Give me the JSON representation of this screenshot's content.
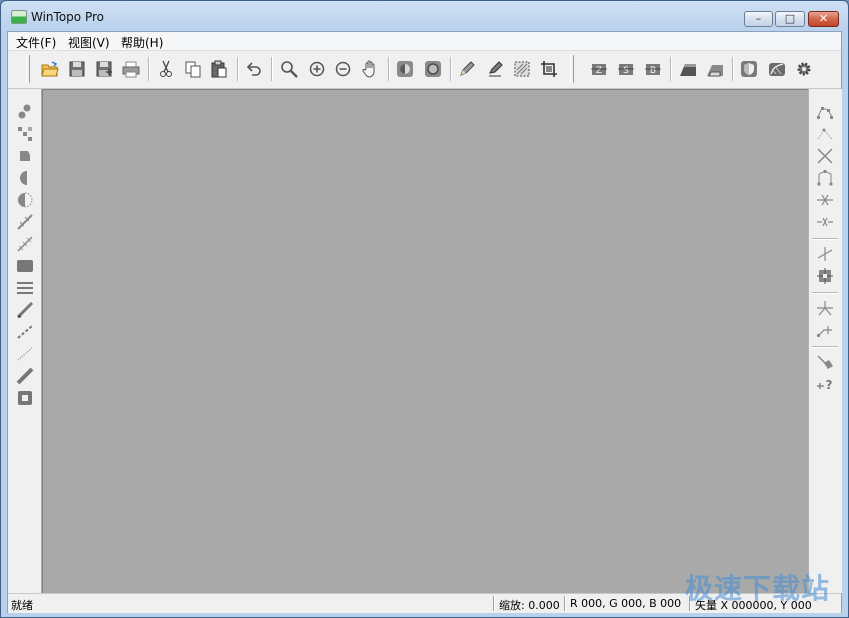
{
  "window": {
    "title": "WinTopo Pro",
    "controls": {
      "minimize": "–",
      "maximize": "□",
      "close": "✕"
    }
  },
  "menubar": {
    "items": [
      {
        "label": "文件(F)"
      },
      {
        "label": "视图(V)"
      },
      {
        "label": "帮助(H)"
      }
    ]
  },
  "toolbar": {
    "buttons": [
      {
        "name": "open-icon"
      },
      {
        "name": "save-icon"
      },
      {
        "name": "save-as-icon"
      },
      {
        "name": "print-icon"
      },
      {
        "name": "cut-icon"
      },
      {
        "name": "copy-icon"
      },
      {
        "name": "paste-icon"
      },
      {
        "name": "undo-icon"
      },
      {
        "name": "magnifier-icon"
      },
      {
        "name": "zoom-in-icon"
      },
      {
        "name": "zoom-out-icon"
      },
      {
        "name": "pan-hand-icon"
      },
      {
        "name": "brightness-icon"
      },
      {
        "name": "contrast-icon"
      },
      {
        "name": "pencil-icon"
      },
      {
        "name": "highlighter-icon"
      },
      {
        "name": "select-area-icon"
      },
      {
        "name": "crop-icon"
      },
      {
        "name": "vector-z-icon"
      },
      {
        "name": "vector-s-icon"
      },
      {
        "name": "vector-b-icon"
      },
      {
        "name": "thinning-icon"
      },
      {
        "name": "skeleton-icon"
      },
      {
        "name": "shield-icon"
      },
      {
        "name": "vectorize-icon"
      },
      {
        "name": "settings-gear-icon"
      }
    ]
  },
  "left_tools": [
    {
      "name": "draw-dots-icon"
    },
    {
      "name": "move-nodes-icon"
    },
    {
      "name": "fill-shape-icon"
    },
    {
      "name": "half-circle-icon"
    },
    {
      "name": "mirror-circle-icon"
    },
    {
      "name": "draw-line-icon"
    },
    {
      "name": "dashed-line-icon"
    },
    {
      "name": "filled-rectangle-icon"
    },
    {
      "name": "horizontal-lines-icon"
    },
    {
      "name": "diagonal-bar-icon"
    },
    {
      "name": "dotted-line-icon"
    },
    {
      "name": "fine-dotted-line-icon"
    },
    {
      "name": "thick-stroke-icon"
    },
    {
      "name": "square-ring-icon"
    }
  ],
  "right_tools": [
    {
      "name": "polyline-icon"
    },
    {
      "name": "dotted-polyline-icon"
    },
    {
      "name": "cross-lines-icon"
    },
    {
      "name": "curve-nodes-icon"
    },
    {
      "name": "join-lines-icon"
    },
    {
      "name": "break-lines-icon"
    },
    {
      "name": "snap-point-icon"
    },
    {
      "name": "node-box-icon"
    },
    {
      "name": "intersection-icon"
    },
    {
      "name": "extend-line-icon"
    },
    {
      "name": "delete-node-icon"
    },
    {
      "name": "help-node-icon"
    }
  ],
  "statusbar": {
    "message": "就绪",
    "zoom": "缩放: 0.000",
    "rgb": "R 000, G 000, B 000",
    "vector": "矢量 X 000000, Y 000"
  },
  "watermark": "极速下载站",
  "colors": {
    "canvas": "#a9a9a9",
    "chrome": "#f0f0f0",
    "titlebar": "#b9d1ec",
    "close_button": "#c3452a"
  }
}
